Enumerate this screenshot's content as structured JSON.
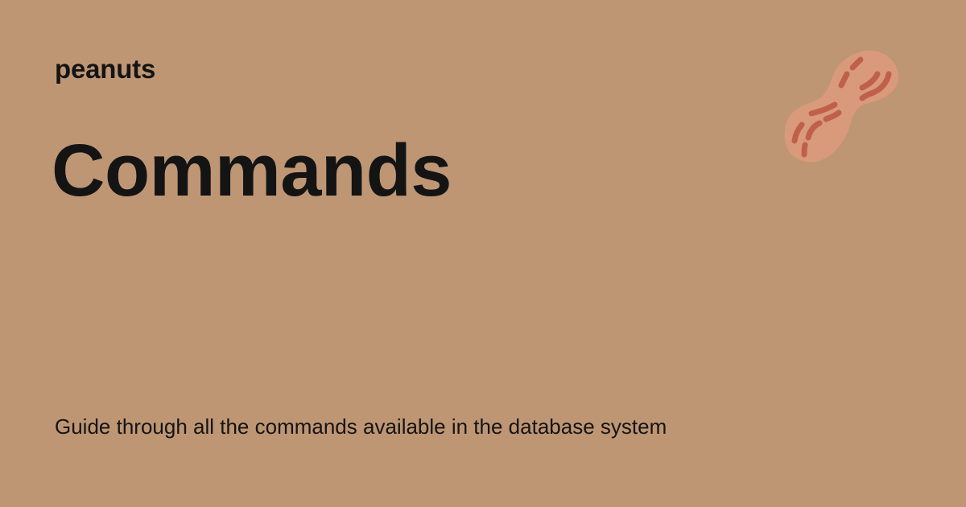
{
  "page": {
    "site_name": "peanuts",
    "title": "Commands",
    "description": "Guide through all the commands available in the database system"
  },
  "logo": {
    "icon": "peanut-icon"
  },
  "colors": {
    "background": "#bf9674",
    "text": "#141414",
    "peanut_shell": "#d99a7b",
    "peanut_lines": "#c0604a"
  }
}
